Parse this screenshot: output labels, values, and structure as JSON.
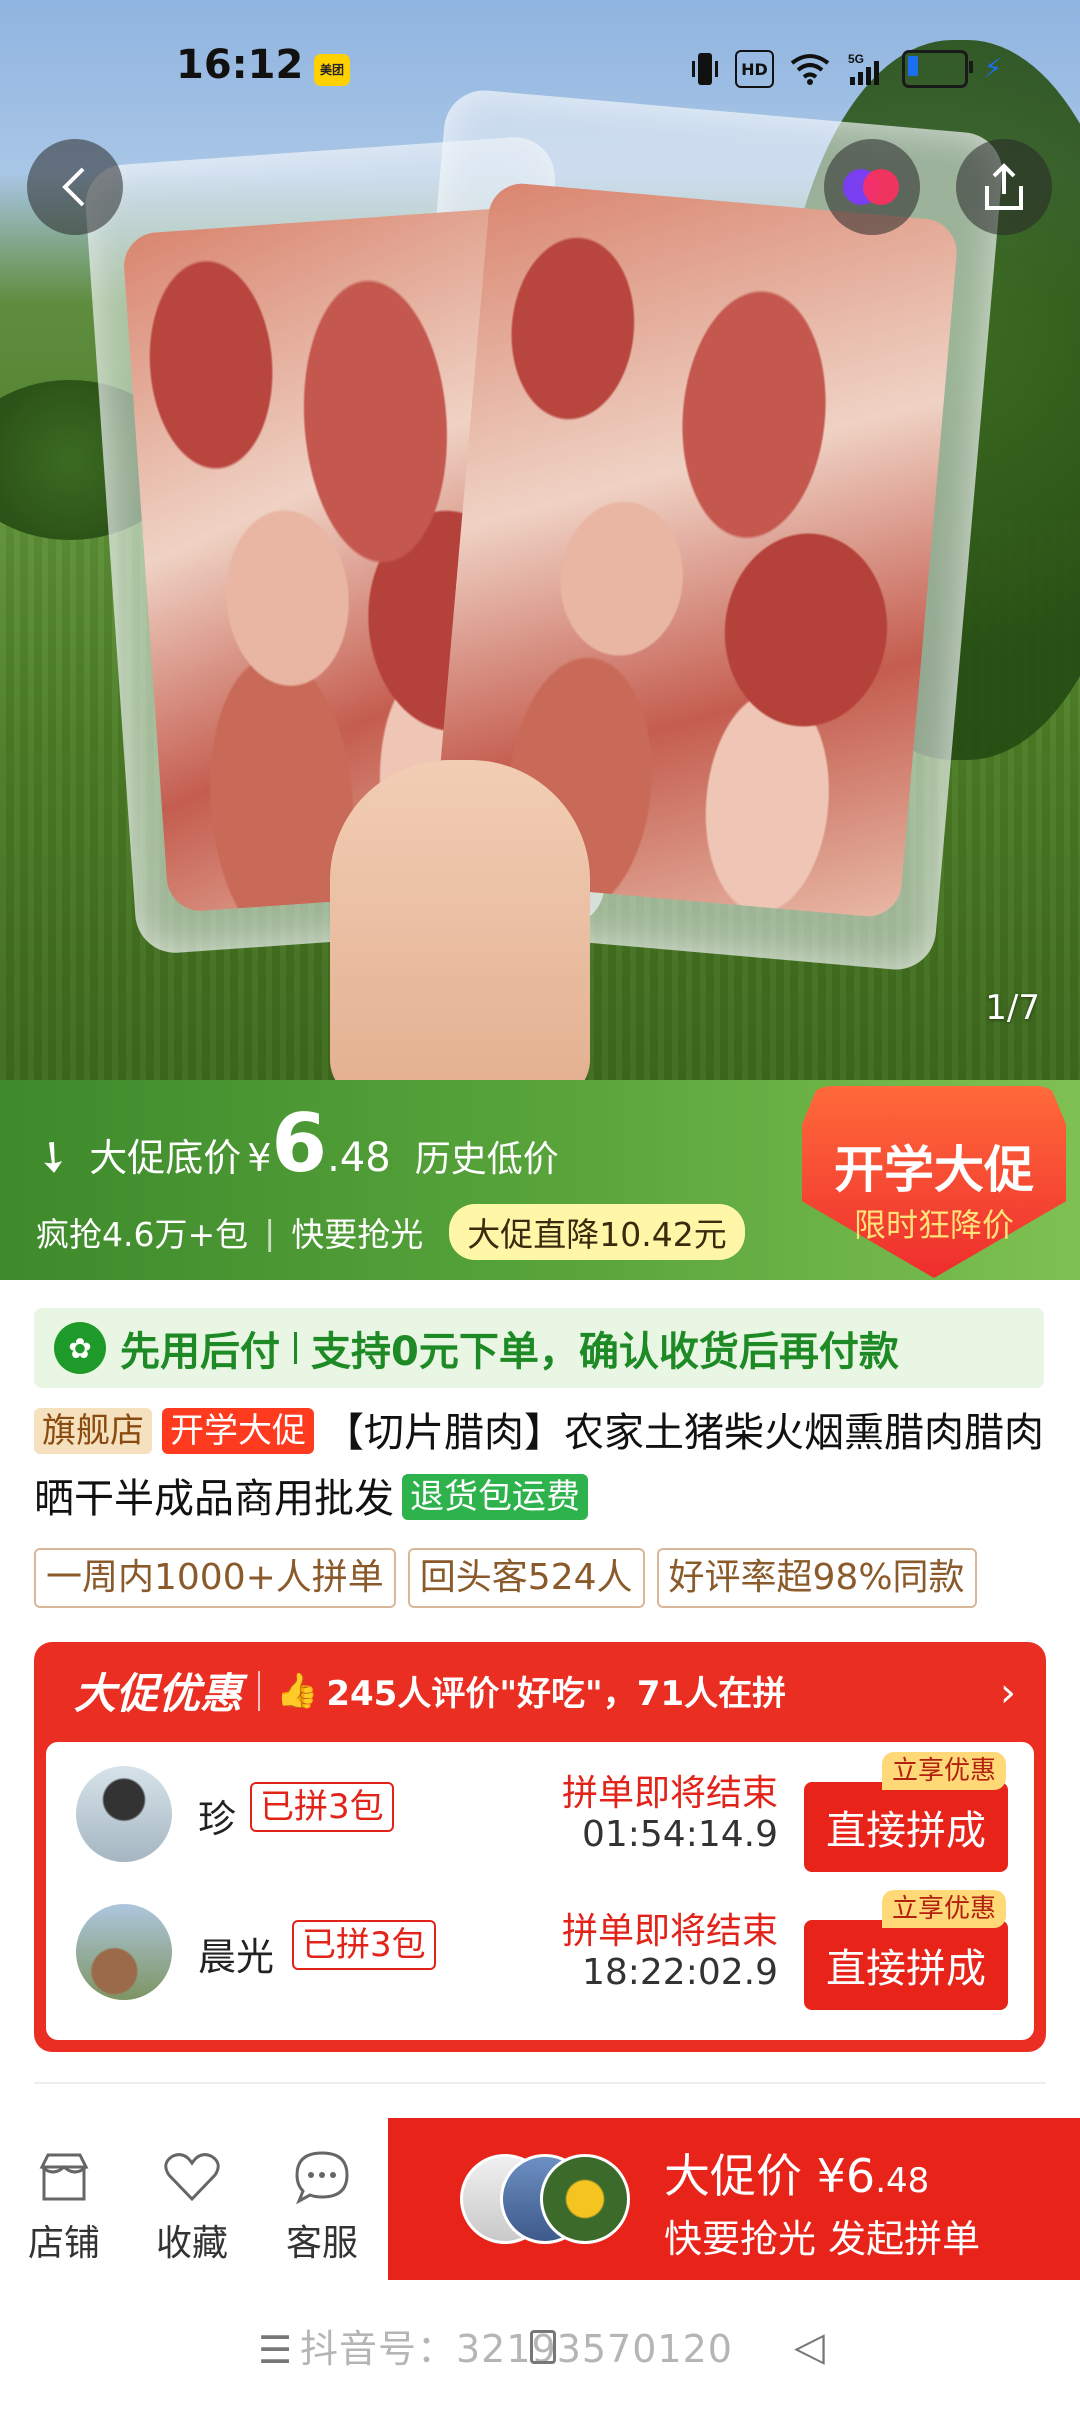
{
  "status_bar": {
    "time": "16:12",
    "app_badge": "美团",
    "network": "5G",
    "hd": "HD"
  },
  "gallery": {
    "counter": "1/7"
  },
  "promo": {
    "label": "大促底价",
    "currency": "¥",
    "price_int": "6",
    "price_dec": ".48",
    "history_low": "历史低价",
    "sold": "疯抢4.6万+包",
    "hurry": "快要抢光",
    "drop_tag": "大促直降10.42元",
    "badge_title": "开学大促",
    "badge_sub": "限时狂降价"
  },
  "pay_later": {
    "title": "先用后付",
    "desc": "支持0元下单，确认收货后再付款"
  },
  "product": {
    "tag_store": "旗舰店",
    "tag_promo": "开学大促",
    "title": "【切片腊肉】农家土猪柴火烟熏腊肉腊肉晒干半成品商用批发",
    "tag_return": "退货包运费"
  },
  "stats": [
    "一周内1000+人拼单",
    "回头客524人",
    "好评率超98%同款"
  ],
  "deal": {
    "brand": "大促优惠",
    "reviews": "245人评价\"好吃\"，71人在拼",
    "groups": [
      {
        "name": "珍",
        "count": "已拼3包",
        "ending": "拼单即将结束",
        "timer": "01:54:14.9",
        "join": "直接拼成",
        "instant": "立享优惠"
      },
      {
        "name": "晨光",
        "count": "已拼3包",
        "ending": "拼单即将结束",
        "timer": "18:22:02.9",
        "join": "直接拼成",
        "instant": "立享优惠"
      }
    ]
  },
  "bottom_bar": {
    "store": "店铺",
    "favorite": "收藏",
    "service": "客服",
    "buy_label": "大促价",
    "buy_currency": "¥",
    "buy_int": "6",
    "buy_dec": ".48",
    "buy_sub": "快要抢光 发起拼单"
  },
  "watermark": "抖音号：32193570120",
  "colors": {
    "promo_green": "#4d9a34",
    "accent_red": "#e8231a",
    "pay_green": "#1e8a26"
  }
}
